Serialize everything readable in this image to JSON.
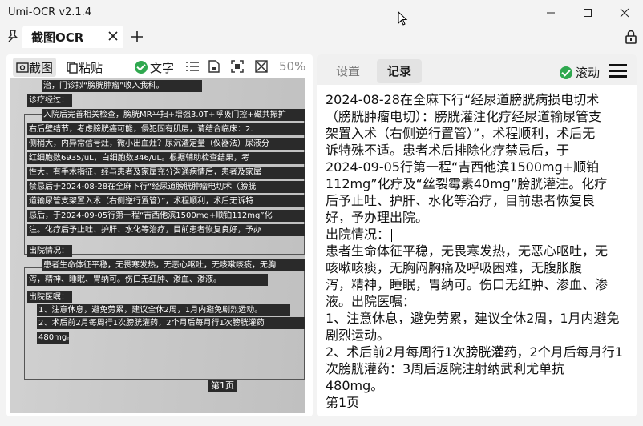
{
  "window": {
    "title": "Umi-OCR v2.1.4"
  },
  "tabs": {
    "active_label": "截图OCR"
  },
  "left_toolbar": {
    "screenshot_label": "截图",
    "paste_label": "粘贴",
    "text_label": "文字",
    "zoom": "50%"
  },
  "document": {
    "lines": [
      "治，门诊拟“膀胱肿瘤”收入我科。",
      "诊疗经过：",
      "入院后完善相关检查，膀胱MR平扫+增强3.0T+呼吸门控+磁共振扩",
      "右后壁结节，考虑膀胱癌可能，侵犯固有肌层，请结合临床：2.",
      "侧稍大，内异常信号灶，微小出血灶？尿沉渣定量（仪器法）尿液分",
      "红细胞数6935/uL，白细胞数346/uL。根据辅助检查结果，考",
      "性大，有手术指征，经与患者及家属充分沟通病情后，患者及家属",
      "禁忌后于2024-08-28在全麻下行“经尿道膀胱肿瘤电切术（膀胱",
      "道输尿管支架置入术（右侧逆行置管）”，术程顺利，术后无诉特",
      "忌后，于2024-09-05行第一程“吉西他滨1500mg+顺铂112mg”化",
      "注。化疗后予止吐、护肝、水化等治疗，目前患者恢复良好，予办",
      "出院情况：",
      "患者生命体征平稳，无畏寒发热，无恶心呕吐，无咳嗽咳痰，无胸",
      "泻，精神、睡眠、胃纳可。伤口无红肿、渗血、渗液。",
      "出院医嘱：",
      "1、注意休息，避免劳累，建议全休2周，1月内避免剧烈运动。",
      "2、术后前2月每周行1次膀胱灌药，2个月后每月行1次膀胱灌药",
      "480mg。"
    ],
    "page_label": "第1页"
  },
  "right_panel": {
    "tab_settings": "设置",
    "tab_records": "记录",
    "scroll_label": "滚动",
    "result_lines": [
      "2024-08-28在全麻下行“经尿道膀胱病损电切术",
      "（膀胱肿瘤电切）：膀胱灌注化疗经尿道输尿管支",
      "架置入术（右侧逆行置管）”，术程顺利，术后无",
      "诉特殊不适。患者术后排除化疗禁忌后，于",
      "2024-09-05行第一程“吉西他滨1500mg+顺铂",
      "112mg”化疗及“丝裂霉素40mg”膀胱灌注。化疗",
      "后予止吐、护肝、水化等治疗，目前患者恢复良",
      "好，予办理出院。",
      "出院情况：",
      "患者生命体征平稳，无畏寒发热，无恶心呕吐，无",
      "咳嗽咳痰，无胸闷胸痛及呼吸困难，无腹胀腹",
      "泻，精神，睡眠，胃纳可。伤口无红肿、渗血、渗",
      "液。出院医嘱：",
      "1、注意休息，避免劳累，建议全休2周，1月内避免",
      "剧烈运动。",
      "2、术后前2月每周行1次膀胱灌药，2个月后每月行1",
      "次膀胱灌药：3周后返院注射纳武利尤单抗",
      "480mg。",
      "第1页"
    ]
  }
}
